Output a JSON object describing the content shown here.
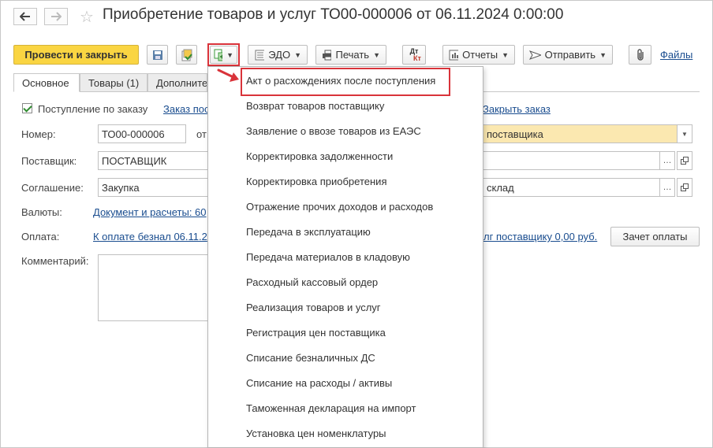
{
  "window": {
    "title": "Приобретение товаров и услуг ТО00-000006 от 06.11.2024 0:00:00"
  },
  "nav": {
    "back_icon": "arrow-left-icon",
    "forward_icon": "arrow-right-icon",
    "favorite_icon": "star-icon"
  },
  "toolbar": {
    "post_close_label": "Провести и закрыть",
    "edo_label": "ЭДО",
    "print_label": "Печать",
    "dt_kt_top": "Дт",
    "dt_kt_bottom": "Кт",
    "reports_label": "Отчеты",
    "send_label": "Отправить",
    "files_label": "Файлы",
    "icons": [
      "save-icon",
      "post-icon",
      "create-based-on-icon",
      "edo-icon",
      "print-icon",
      "dt-kt-icon",
      "reports-icon",
      "send-icon",
      "attachment-icon"
    ]
  },
  "tabs": [
    "Основное",
    "Товары (1)",
    "Дополнительно"
  ],
  "form": {
    "by_order_label": "Поступление по заказу",
    "order_link": "Заказ пос",
    "close_order_link": "Закрыть заказ",
    "number_label": "Номер:",
    "number_value": "ТО00-000006",
    "from_label": "от",
    "supplier_label": "Поставщик:",
    "supplier_value": "ПОСТАВЩИК",
    "agreement_label": "Соглашение:",
    "agreement_value": "Закупка",
    "currency_label": "Валюты:",
    "currency_link": "Документ и расчеты: 60",
    "payment_label": "Оплата:",
    "payment_link": "К оплате безнал 06.11.2",
    "debt_link": "лг поставщику 0,00 руб.",
    "offset_button": "Зачет оплаты",
    "comment_label": "Комментарий:",
    "right_select_value": "поставщика",
    "warehouse_value": "склад"
  },
  "menu": {
    "items": [
      "Акт о расхождениях после поступления",
      "Возврат товаров поставщику",
      "Заявление о ввозе товаров из ЕАЭС",
      "Корректировка задолженности",
      "Корректировка приобретения",
      "Отражение прочих доходов и расходов",
      "Передача в эксплуатацию",
      "Передача материалов в кладовую",
      "Расходный кассовый ордер",
      "Реализация товаров и услуг",
      "Регистрация цен поставщика",
      "Списание безналичных ДС",
      "Списание на расходы / активы",
      "Таможенная декларация на импорт",
      "Установка цен номенклатуры"
    ],
    "highlighted_index": 0
  },
  "colors": {
    "primary": "#fad542",
    "link": "#1a4d8f",
    "highlight": "#d9333a",
    "selected_field": "#fbe8b0"
  }
}
